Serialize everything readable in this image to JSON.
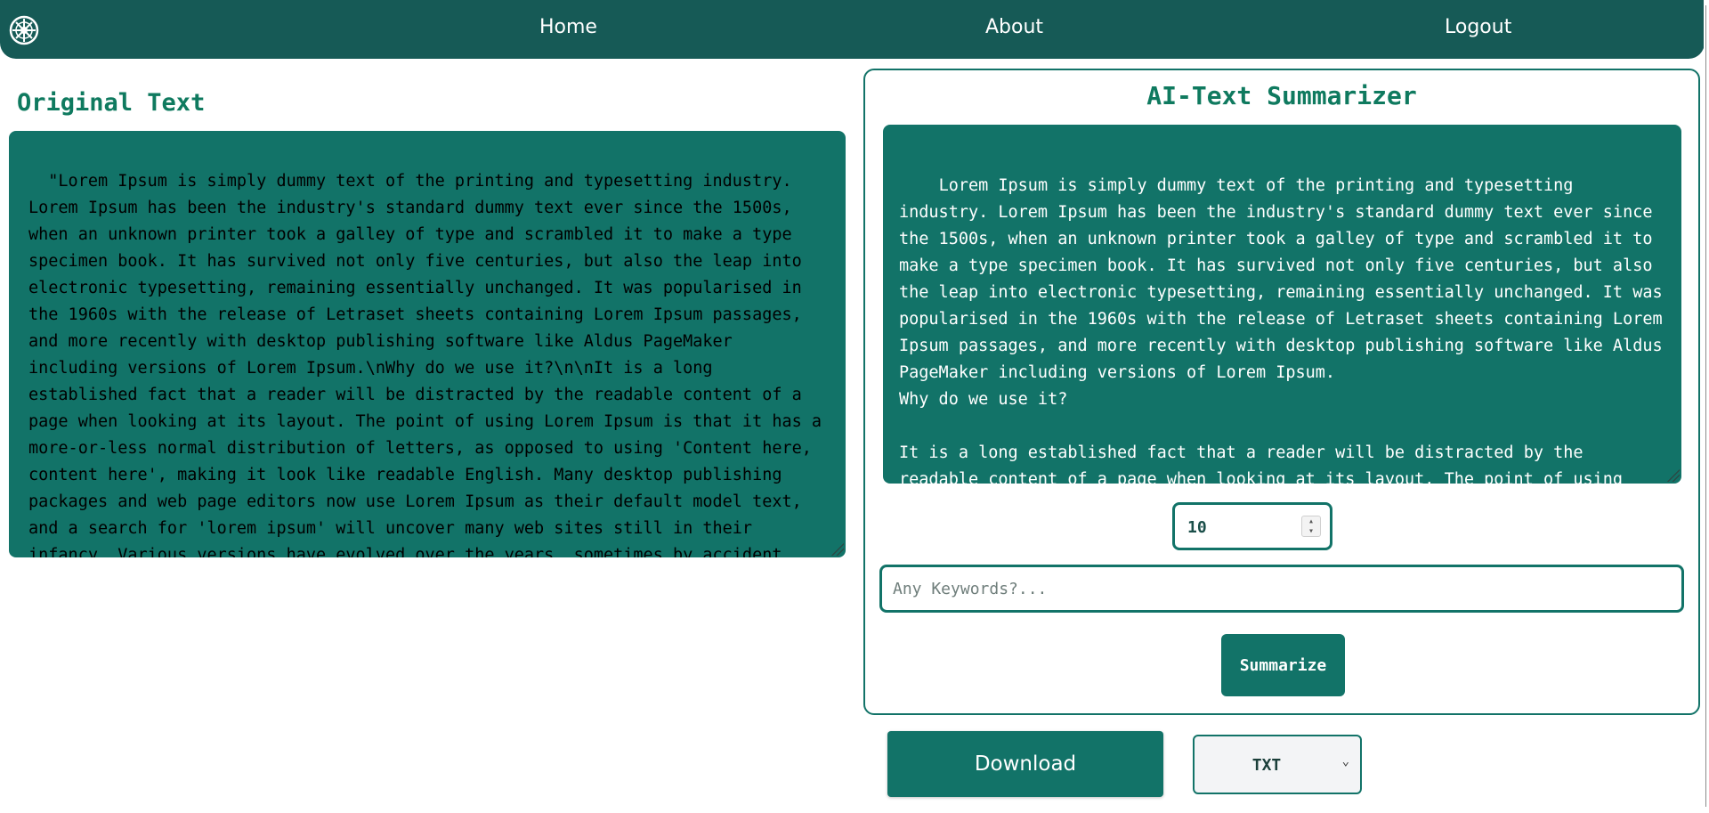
{
  "nav": {
    "logo_icon": "wheel-logo-icon",
    "home": "Home",
    "about": "About",
    "logout": "Logout"
  },
  "original": {
    "title": "Original Text",
    "text": "\"Lorem Ipsum is simply dummy text of the printing and typesetting industry. Lorem Ipsum has been the industry's standard dummy text ever since the 1500s, when an unknown printer took a galley of type and scrambled it to make a type specimen book. It has survived not only five centuries, but also the leap into electronic typesetting, remaining essentially unchanged. It was popularised in the 1960s with the release of Letraset sheets containing Lorem Ipsum passages, and more recently with desktop publishing software like Aldus PageMaker including versions of Lorem Ipsum.\\nWhy do we use it?\\n\\nIt is a long established fact that a reader will be distracted by the readable content of a page when looking at its layout. The point of using Lorem Ipsum is that it has a more-or-less normal distribution of letters, as opposed to using 'Content here, content here', making it look like readable English. Many desktop publishing packages and web page editors now use Lorem Ipsum as their default model text, and a search for 'lorem ipsum' will uncover many web sites still in their infancy. Various versions have evolved over the years, sometimes by accident, sometimes on purpose (injected humour and the like).\\n\\nWhere does it come from?\\n\\nContrary to popular belief, Lorem Ipsum is"
  },
  "summarizer": {
    "title": "AI-Text Summarizer",
    "summary_text": "Lorem Ipsum is simply dummy text of the printing and typesetting industry. Lorem Ipsum has been the industry's standard dummy text ever since the 1500s, when an unknown printer took a galley of type and scrambled it to make a type specimen book. It has survived not only five centuries, but also the leap into electronic typesetting, remaining essentially unchanged. It was popularised in the 1960s with the release of Letraset sheets containing Lorem Ipsum passages, and more recently with desktop publishing software like Aldus PageMaker including versions of Lorem Ipsum.\nWhy do we use it?\n\nIt is a long established fact that a reader will be distracted by the readable content of a page when looking at its layout. The point of using Lorem Ipsum is that it has a more-or-less normal distribution of letters, as opposed to",
    "count_value": "10",
    "keywords_placeholder": "Any Keywords?...",
    "keywords_value": "",
    "summarize_label": "Summarize"
  },
  "download": {
    "label": "Download",
    "format_selected": "TXT"
  },
  "colors": {
    "topbar": "#165a56",
    "accent": "#127368",
    "title_green": "#0f7a5f"
  }
}
